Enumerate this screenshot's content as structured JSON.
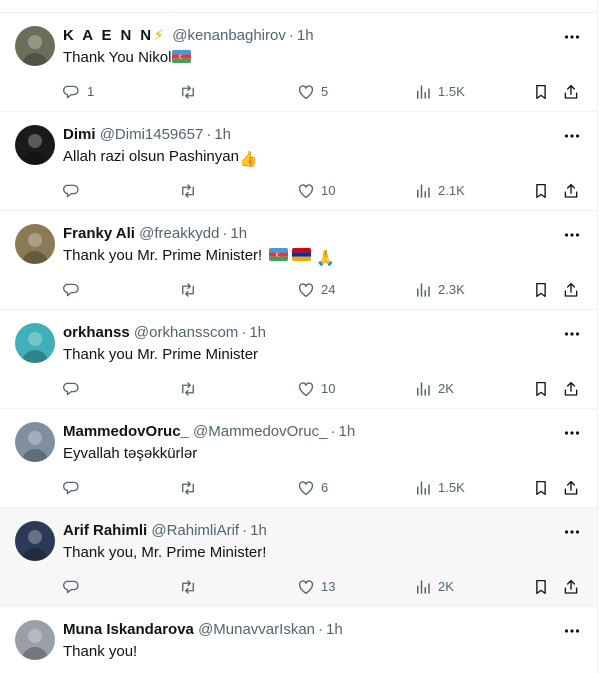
{
  "tweets": [
    {
      "name": "K A E N N",
      "badge": "⚡",
      "handle": "@kenanbaghirov",
      "time": "1h",
      "text": "Thank You Nikol",
      "replies": "1",
      "retweets": "",
      "likes": "5",
      "views": "1.5K",
      "avatar_color": "#6b6f5a"
    },
    {
      "name": "Dimi",
      "badge": "",
      "handle": "@Dimi1459657",
      "time": "1h",
      "text": "Allah razi olsun Pashinyan",
      "replies": "",
      "retweets": "",
      "likes": "10",
      "views": "2.1K",
      "avatar_color": "#1a1a1a"
    },
    {
      "name": "Franky Ali",
      "badge": "",
      "handle": "@freakkydd",
      "time": "1h",
      "text": "Thank you Mr. Prime Minister!",
      "replies": "",
      "retweets": "",
      "likes": "24",
      "views": "2.3K",
      "avatar_color": "#8a7a55"
    },
    {
      "name": "orkhanss",
      "badge": "",
      "handle": "@orkhansscom",
      "time": "1h",
      "text": "Thank you Mr. Prime Minister",
      "replies": "",
      "retweets": "",
      "likes": "10",
      "views": "2K",
      "avatar_color": "#3fb0b8"
    },
    {
      "name": "MammedovOruc_",
      "badge": "",
      "handle": "@MammedovOruc_",
      "time": "1h",
      "text": "Eyvallah təşəkkürlər",
      "replies": "",
      "retweets": "",
      "likes": "6",
      "views": "1.5K",
      "avatar_color": "#7f8fa0"
    },
    {
      "name": "Arif Rahimli",
      "badge": "",
      "handle": "@RahimliArif",
      "time": "1h",
      "text": "Thank you, Mr. Prime Minister!",
      "replies": "",
      "retweets": "",
      "likes": "13",
      "views": "2K",
      "avatar_color": "#2b3a55"
    },
    {
      "name": "Muna Iskandarova",
      "badge": "",
      "handle": "@MunavvarIskan",
      "time": "1h",
      "text": "Thank you!",
      "replies": "",
      "retweets": "",
      "likes": "",
      "views": "",
      "avatar_color": "#9aa0a8"
    }
  ],
  "separator": "·",
  "emoji": {
    "thumbs_up": "👍",
    "pray": "🙏"
  },
  "icons": {
    "reply": "reply-icon",
    "retweet": "retweet-icon",
    "like": "heart-icon",
    "views": "views-icon",
    "bookmark": "bookmark-icon",
    "share": "share-icon",
    "more": "more-icon"
  },
  "colors": {
    "text": "#0f1419",
    "secondary": "#536471",
    "border": "#eff3f4",
    "highlight_bg": "#f7f7f7"
  }
}
